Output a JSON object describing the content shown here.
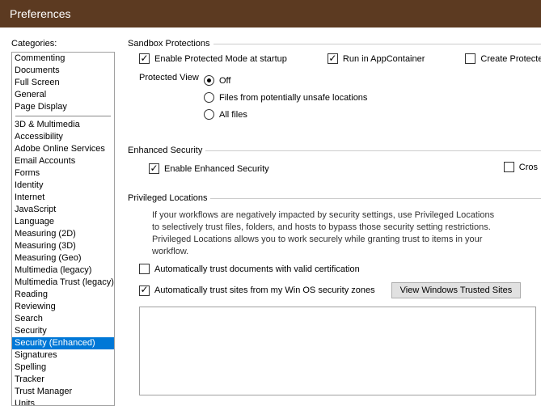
{
  "titlebar": {
    "title": "Preferences"
  },
  "sidebar": {
    "label": "Categories:",
    "group1": [
      {
        "label": "Commenting"
      },
      {
        "label": "Documents"
      },
      {
        "label": "Full Screen"
      },
      {
        "label": "General"
      },
      {
        "label": "Page Display"
      }
    ],
    "group2": [
      {
        "label": "3D & Multimedia"
      },
      {
        "label": "Accessibility"
      },
      {
        "label": "Adobe Online Services"
      },
      {
        "label": "Email Accounts"
      },
      {
        "label": "Forms"
      },
      {
        "label": "Identity"
      },
      {
        "label": "Internet"
      },
      {
        "label": "JavaScript"
      },
      {
        "label": "Language"
      },
      {
        "label": "Measuring (2D)"
      },
      {
        "label": "Measuring (3D)"
      },
      {
        "label": "Measuring (Geo)"
      },
      {
        "label": "Multimedia (legacy)"
      },
      {
        "label": "Multimedia Trust (legacy)"
      },
      {
        "label": "Reading"
      },
      {
        "label": "Reviewing"
      },
      {
        "label": "Search"
      },
      {
        "label": "Security"
      },
      {
        "label": "Security (Enhanced)",
        "selected": true
      },
      {
        "label": "Signatures"
      },
      {
        "label": "Spelling"
      },
      {
        "label": "Tracker"
      },
      {
        "label": "Trust Manager"
      },
      {
        "label": "Units"
      }
    ]
  },
  "sandbox": {
    "legend": "Sandbox Protections",
    "protectedMode": "Enable Protected Mode at startup",
    "appContainer": "Run in AppContainer",
    "createLog": "Create Protected Mode log fil",
    "protectedViewLabel": "Protected View",
    "pv_off": "Off",
    "pv_unsafe": "Files from potentially unsafe locations",
    "pv_all": "All files"
  },
  "enhanced": {
    "legend": "Enhanced Security",
    "enable": "Enable Enhanced Security",
    "cross": "Cros"
  },
  "privileged": {
    "legend": "Privileged Locations",
    "note": "If your workflows are negatively impacted by security settings, use Privileged Locations to selectively trust files, folders, and hosts to bypass those security setting restrictions. Privileged Locations allows you to work securely while granting trust to items in your workflow.",
    "autoTrustCert": "Automatically trust documents with valid certification",
    "autoTrustSites": "Automatically trust sites from my Win OS security zones",
    "viewSitesBtn": "View Windows Trusted Sites"
  }
}
